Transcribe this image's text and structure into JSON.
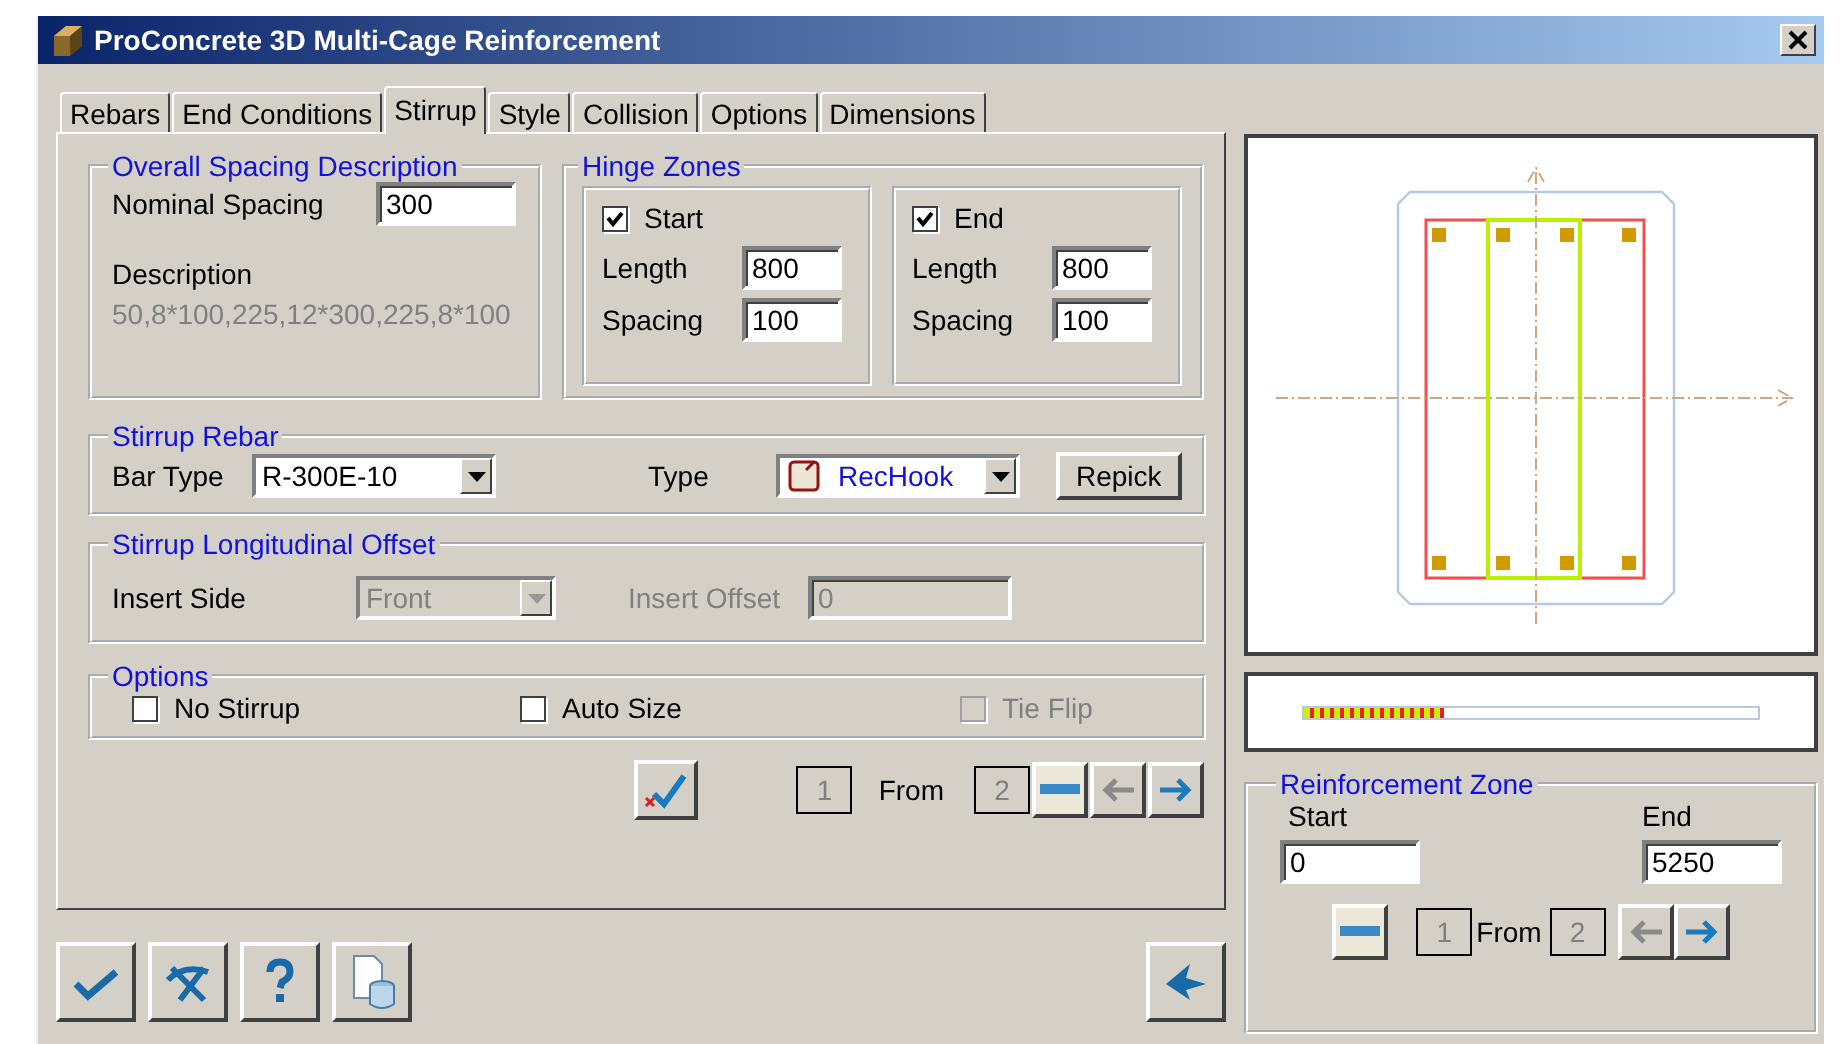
{
  "window": {
    "title": "ProConcrete 3D Multi-Cage Reinforcement"
  },
  "tabs": [
    {
      "label": "Rebars",
      "selected": false
    },
    {
      "label": "End Conditions",
      "selected": false
    },
    {
      "label": "Stirrup",
      "selected": true
    },
    {
      "label": "Style",
      "selected": false
    },
    {
      "label": "Collision",
      "selected": false
    },
    {
      "label": "Options",
      "selected": false
    },
    {
      "label": "Dimensions",
      "selected": false
    }
  ],
  "overall_spacing": {
    "title": "Overall Spacing Description",
    "nominal_label": "Nominal Spacing",
    "nominal_value": "300",
    "description_label": "Description",
    "description_value": "50,8*100,225,12*300,225,8*100"
  },
  "hinge_zones": {
    "title": "Hinge Zones",
    "zones": [
      {
        "label": "Start",
        "checked": true,
        "length_label": "Length",
        "length_value": "800",
        "spacing_label": "Spacing",
        "spacing_value": "100"
      },
      {
        "label": "End",
        "checked": true,
        "length_label": "Length",
        "length_value": "800",
        "spacing_label": "Spacing",
        "spacing_value": "100"
      }
    ]
  },
  "stirrup_rebar": {
    "title": "Stirrup Rebar",
    "bar_type_label": "Bar Type",
    "bar_type_value": "R-300E-10",
    "type_label": "Type",
    "type_value": "RecHook",
    "repick_button": "Repick"
  },
  "longitudinal_offset": {
    "title": "Stirrup Longitudinal Offset",
    "insert_side_label": "Insert Side",
    "insert_side_value": "Front",
    "insert_offset_label": "Insert Offset",
    "insert_offset_value": "0",
    "disabled": true
  },
  "options": {
    "title": "Options",
    "items": [
      {
        "label": "No Stirrup",
        "checked": false,
        "disabled": false
      },
      {
        "label": "Auto Size",
        "checked": false,
        "disabled": false
      },
      {
        "label": "Tie Flip",
        "checked": false,
        "disabled": true
      }
    ]
  },
  "pager": {
    "current": "1",
    "from_label": "From",
    "total": "2"
  },
  "zone_bar": {
    "level": 0.31
  },
  "reinforcement_zone": {
    "title": "Reinforcement Zone",
    "start_label": "Start",
    "start_value": "0",
    "end_label": "End",
    "end_value": "5250",
    "pager": {
      "current": "1",
      "from_label": "From",
      "total": "2"
    }
  }
}
